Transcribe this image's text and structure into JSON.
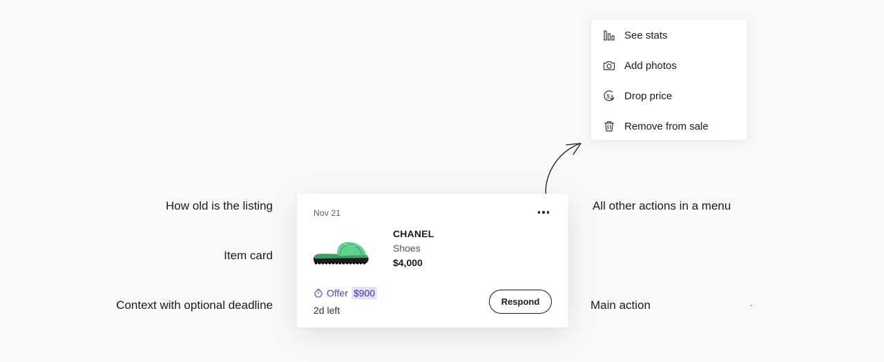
{
  "annotations": {
    "age": "How old is the listing",
    "card": "Item card",
    "context": "Context with optional deadline",
    "menu": "All other actions in a menu",
    "main_action": "Main action"
  },
  "card": {
    "date": "Nov 21",
    "brand": "CHANEL",
    "category": "Shoes",
    "price": "$4,000",
    "offer_label": "Offer",
    "offer_amount": "$900",
    "time_left": "2d left",
    "respond_label": "Respond",
    "image_icon": "green-slide-sandal",
    "colors": {
      "offer_accent": "#4a3fd6",
      "offer_highlight": "#e3e1fb",
      "sandal_green": "#5fd38e"
    }
  },
  "menu": {
    "items": [
      {
        "label": "See stats",
        "icon": "bar-chart-icon"
      },
      {
        "label": "Add photos",
        "icon": "camera-icon"
      },
      {
        "label": "Drop price",
        "icon": "price-drop-icon"
      },
      {
        "label": "Remove from sale",
        "icon": "trash-icon"
      }
    ]
  }
}
